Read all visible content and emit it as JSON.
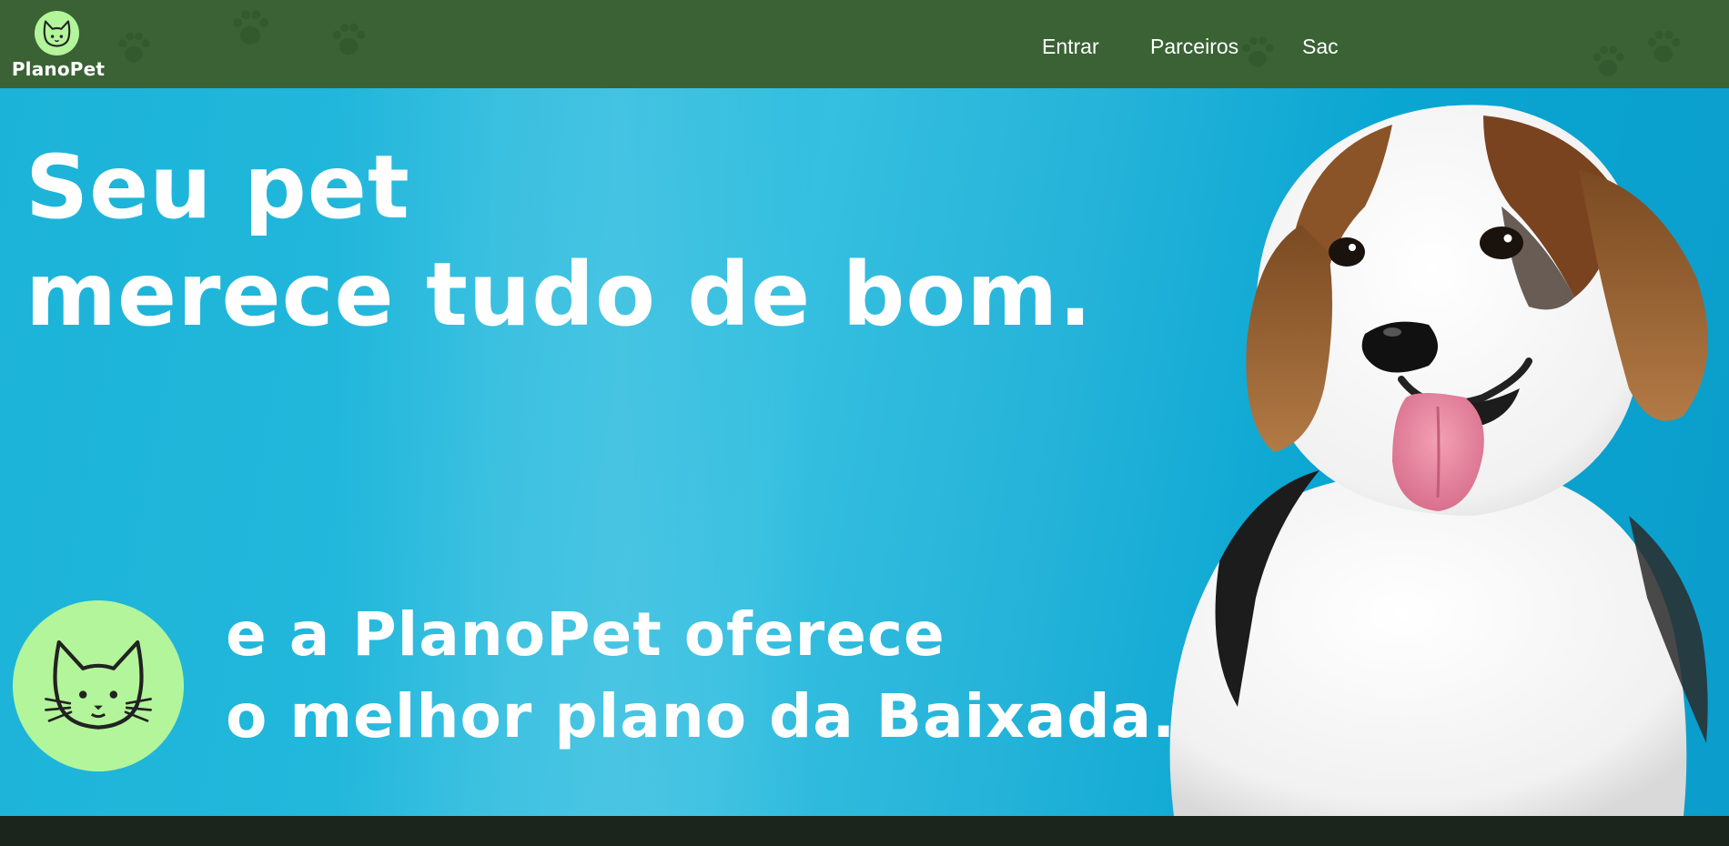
{
  "header": {
    "logo_text": "PlanoPet",
    "logo_icon": "cat-icon",
    "nav": [
      {
        "label": "Entrar"
      },
      {
        "label": "Parceiros"
      },
      {
        "label": "Sac"
      }
    ]
  },
  "hero": {
    "headline_line1": "Seu pet",
    "headline_line2": "merece tudo de bom.",
    "sub_line1": "e a PlanoPet oferece",
    "sub_line2": "o melhor plano da Baixada.",
    "badge_icon": "cat-icon",
    "image": "beagle-puppy"
  },
  "colors": {
    "header_bg": "#3a6235",
    "badge_green": "#b3f59a",
    "hero_blue": "#1cb3d8",
    "text": "#ffffff",
    "footer_bg": "#1b251c"
  }
}
